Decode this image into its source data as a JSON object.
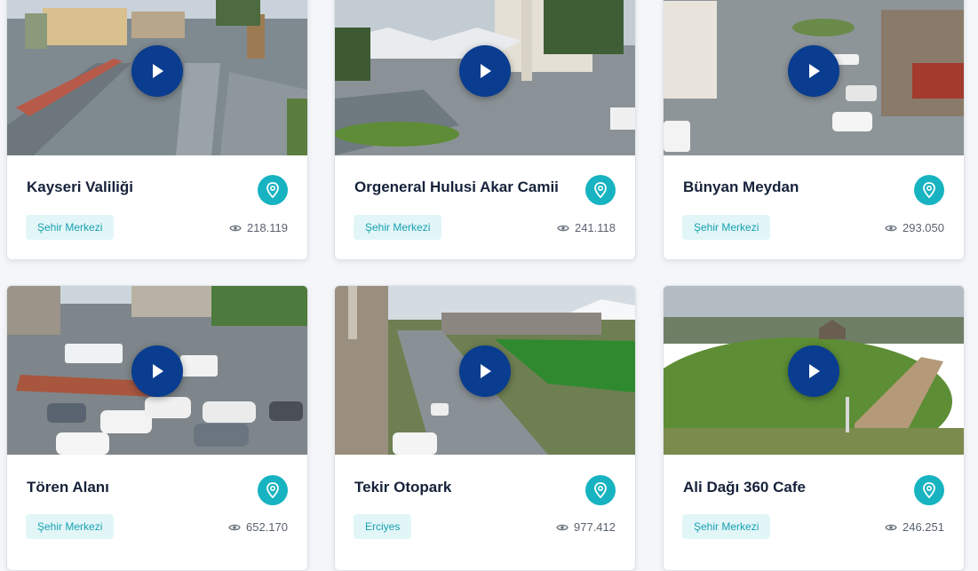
{
  "cameras": [
    {
      "title": "Kayseri Valiliği",
      "tag": "Şehir Merkezi",
      "views": "218.119",
      "play_icon": "play-icon",
      "location_icon": "map-pin-icon",
      "views_icon": "eye-icon"
    },
    {
      "title": "Orgeneral Hulusi Akar Camii",
      "tag": "Şehir Merkezi",
      "views": "241.118",
      "play_icon": "play-icon",
      "location_icon": "map-pin-icon",
      "views_icon": "eye-icon"
    },
    {
      "title": "Bünyan Meydan",
      "tag": "Şehir Merkezi",
      "views": "293.050",
      "play_icon": "play-icon",
      "location_icon": "map-pin-icon",
      "views_icon": "eye-icon"
    },
    {
      "title": "Tören Alanı",
      "tag": "Şehir Merkezi",
      "views": "652.170",
      "play_icon": "play-icon",
      "location_icon": "map-pin-icon",
      "views_icon": "eye-icon"
    },
    {
      "title": "Tekir Otopark",
      "tag": "Erciyes",
      "views": "977.412",
      "play_icon": "play-icon",
      "location_icon": "map-pin-icon",
      "views_icon": "eye-icon"
    },
    {
      "title": "Ali Dağı 360 Cafe",
      "tag": "Şehir Merkezi",
      "views": "246.251",
      "play_icon": "play-icon",
      "location_icon": "map-pin-icon",
      "views_icon": "eye-icon"
    }
  ],
  "colors": {
    "play_button": "#0a3d8f",
    "location_pin": "#17b3c1",
    "tag_text": "#17a0b0",
    "tag_background": "#e2f6f8",
    "title_text": "#16223a"
  }
}
